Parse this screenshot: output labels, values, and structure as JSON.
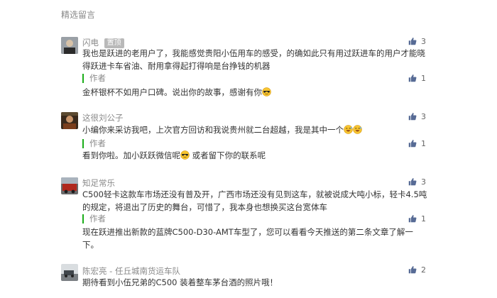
{
  "section_title": "精选留言",
  "colors": {
    "like_icon": "#576b95",
    "reply_bar": "#1aad19",
    "text": "#333333",
    "muted": "#8a8a8a"
  },
  "comments": [
    {
      "nickname": "闪电",
      "badge": "置顶",
      "likes": "3",
      "text": "我也是跃进的老用户了，我能感觉贵阳小伍用车的感受，的确如此只有用过跃进车的用户才能晓得跃进卡车省油、耐用拿得起打得响是台挣钱的机器",
      "reply_label": "作者",
      "reply_likes": "1",
      "reply_text": "金杯银杯不如用户口碑。说出你的故事，感谢有你"
    },
    {
      "nickname": "这很刘公子",
      "likes": "3",
      "text": "小编你来采访我吧，上次官方回访和我说贵州就二台超越，我是其中一个",
      "reply_label": "作者",
      "reply_likes": "1",
      "reply_text_a": "看到你啦。加小跃跃微信呢",
      "reply_text_b": " 或者留下你的联系呢"
    },
    {
      "nickname": "知足常乐",
      "likes": "3",
      "text": "C500轻卡这款车市场还没有普及开，广西市场还没有见到这车，就被说成大吨小标，轻卡4.5吨的规定，将退出了历史的舞台，可惜了，我本身也想换买这台宽体车",
      "reply_label": "作者",
      "reply_likes": "1",
      "reply_text": "现在跃进推出新款的蓝牌C500-D30-AMT车型了，您可以看看今天推送的第二条文章了解一下。"
    },
    {
      "nickname": "陈宏亮 - 任丘城南货运车队",
      "likes": "2",
      "text": "期待看到小伍兄弟的C500 装着整车茅台酒的照片哦！"
    }
  ]
}
